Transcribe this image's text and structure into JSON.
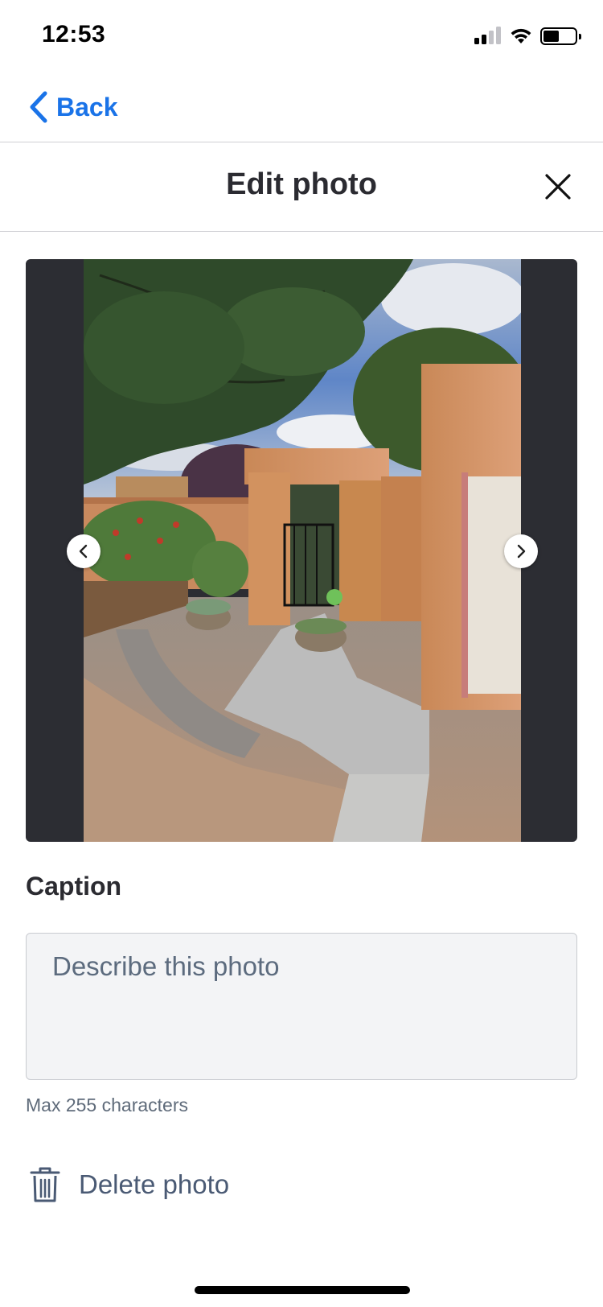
{
  "status_bar": {
    "time": "12:53",
    "signal_icon": "cellular-signal-icon",
    "wifi_icon": "wifi-icon",
    "battery_icon": "battery-icon",
    "battery_level": 0.5
  },
  "nav": {
    "back_label": "Back",
    "back_icon": "chevron-left-icon",
    "accent_color": "#1a73e8"
  },
  "header": {
    "title": "Edit photo",
    "close_icon": "close-icon"
  },
  "photo": {
    "prev_icon": "chevron-left-icon",
    "next_icon": "chevron-right-icon"
  },
  "caption": {
    "label": "Caption",
    "value": "",
    "placeholder": "Describe this photo",
    "hint": "Max 255 characters"
  },
  "delete": {
    "label": "Delete photo",
    "icon": "trash-icon"
  }
}
